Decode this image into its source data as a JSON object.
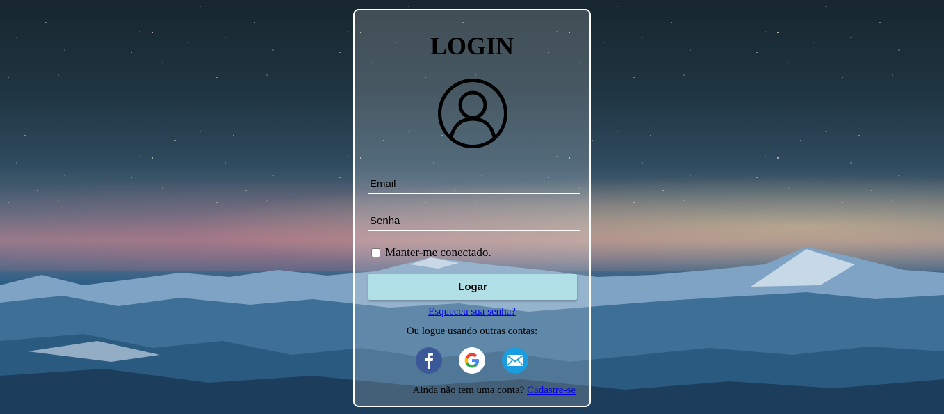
{
  "login": {
    "title": "LOGIN",
    "email_placeholder": "Email",
    "password_placeholder": "Senha",
    "remember_label": "Manter-me conectado.",
    "submit_label": "Logar",
    "forgot_link": "Esqueceu sua senha?",
    "other_accounts_text": "Ou logue usando outras contas:",
    "signup_prompt": "Ainda não tem uma conta?",
    "signup_link": "Cadastre-se"
  },
  "socials": [
    {
      "icon": "facebook-icon",
      "color": "#3b5998"
    },
    {
      "icon": "google-icon",
      "color": "#ffffff"
    },
    {
      "icon": "mail-icon",
      "color": "#1a9de0"
    }
  ],
  "colors": {
    "button_bg": "#b0e0e6",
    "link": "#0000ee",
    "card_border": "#ffffff"
  }
}
